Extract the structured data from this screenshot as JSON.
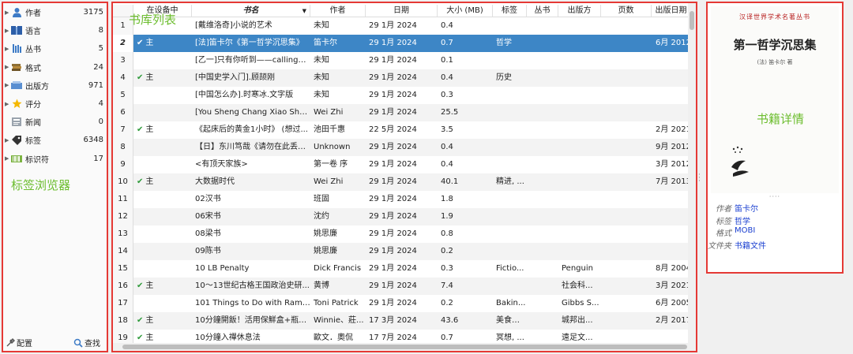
{
  "tag_browser": {
    "annotation": "标签浏览器",
    "items": [
      {
        "label": "作者",
        "count": "3175",
        "icon": "person-icon",
        "arrow": true
      },
      {
        "label": "语言",
        "count": "8",
        "icon": "language-icon",
        "arrow": true
      },
      {
        "label": "丛书",
        "count": "5",
        "icon": "series-icon",
        "arrow": true
      },
      {
        "label": "格式",
        "count": "24",
        "icon": "format-icon",
        "arrow": true
      },
      {
        "label": "出版方",
        "count": "971",
        "icon": "publisher-icon",
        "arrow": true
      },
      {
        "label": "评分",
        "count": "4",
        "icon": "star-icon",
        "arrow": true
      },
      {
        "label": "新闻",
        "count": "0",
        "icon": "news-icon",
        "arrow": false
      },
      {
        "label": "标签",
        "count": "6348",
        "icon": "tag-icon",
        "arrow": true
      },
      {
        "label": "标识符",
        "count": "17",
        "icon": "barcode-icon",
        "arrow": true
      }
    ],
    "configure_label": "配置",
    "find_label": "查找"
  },
  "library": {
    "annotation": "书库列表",
    "columns": {
      "on_device": "在设备中",
      "title": "书名",
      "author": "作者",
      "date": "日期",
      "size": "大小 (MB)",
      "tags": "标签",
      "series": "丛书",
      "publisher": "出版方",
      "pages": "页数",
      "published": "出版日期"
    },
    "rows": [
      {
        "num": "1",
        "device": "",
        "title": "[戴维洛奇]小说的艺术",
        "author": "未知",
        "date": "29 1月 2024",
        "size": "0.4",
        "tags": "",
        "series": "",
        "publisher": "",
        "pages": "",
        "published": ""
      },
      {
        "num": "2",
        "device": "主",
        "title": "[法]笛卡尔《第一哲学沉思集》",
        "author": "笛卡尔",
        "date": "29 1月 2024",
        "size": "0.7",
        "tags": "哲学",
        "series": "",
        "publisher": "",
        "pages": "",
        "published": "6月 2012"
      },
      {
        "num": "3",
        "device": "",
        "title": "[乙一]只有你听到——calling+y...",
        "author": "未知",
        "date": "29 1月 2024",
        "size": "0.1",
        "tags": "",
        "series": "",
        "publisher": "",
        "pages": "",
        "published": ""
      },
      {
        "num": "4",
        "device": "主",
        "title": "[中国史学入门].顾颉刚",
        "author": "未知",
        "date": "29 1月 2024",
        "size": "0.4",
        "tags": "历史",
        "series": "",
        "publisher": "",
        "pages": "",
        "published": ""
      },
      {
        "num": "5",
        "device": "",
        "title": "[中国怎么办].时寒冰.文字版",
        "author": "未知",
        "date": "29 1月 2024",
        "size": "0.3",
        "tags": "",
        "series": "",
        "publisher": "",
        "pages": "",
        "published": ""
      },
      {
        "num": "6",
        "device": "",
        "title": "[You Sheng Chang Xiao Shu ...",
        "author": "Wei Zhi",
        "date": "29 1月 2024",
        "size": "25.5",
        "tags": "",
        "series": "",
        "publisher": "",
        "pages": "",
        "published": ""
      },
      {
        "num": "7",
        "device": "主",
        "title": "《起床后的黄金1小时》 (想过...",
        "author": "池田千惠",
        "date": "22 5月 2024",
        "size": "3.5",
        "tags": "",
        "series": "",
        "publisher": "",
        "pages": "",
        "published": "2月 2021"
      },
      {
        "num": "8",
        "device": "",
        "title": "【日】东川笃哉《请勿在此丢弃...",
        "author": "Unknown",
        "date": "29 1月 2024",
        "size": "0.4",
        "tags": "",
        "series": "",
        "publisher": "",
        "pages": "",
        "published": "9月 2012"
      },
      {
        "num": "9",
        "device": "",
        "title": "<有顶天家族>",
        "author": "第一卷 序",
        "date": "29 1月 2024",
        "size": "0.4",
        "tags": "",
        "series": "",
        "publisher": "",
        "pages": "",
        "published": "3月 2012"
      },
      {
        "num": "10",
        "device": "主",
        "title": "大数据时代",
        "author": "Wei Zhi",
        "date": "29 1月 2024",
        "size": "40.1",
        "tags": "精进, ...",
        "series": "",
        "publisher": "",
        "pages": "",
        "published": "7月 2013"
      },
      {
        "num": "11",
        "device": "",
        "title": "02汉书",
        "author": "班固",
        "date": "29 1月 2024",
        "size": "1.8",
        "tags": "",
        "series": "",
        "publisher": "",
        "pages": "",
        "published": ""
      },
      {
        "num": "12",
        "device": "",
        "title": "06宋书",
        "author": "沈约",
        "date": "29 1月 2024",
        "size": "1.9",
        "tags": "",
        "series": "",
        "publisher": "",
        "pages": "",
        "published": ""
      },
      {
        "num": "13",
        "device": "",
        "title": "08梁书",
        "author": "姚思廉",
        "date": "29 1月 2024",
        "size": "0.8",
        "tags": "",
        "series": "",
        "publisher": "",
        "pages": "",
        "published": ""
      },
      {
        "num": "14",
        "device": "",
        "title": "09陈书",
        "author": "姚思廉",
        "date": "29 1月 2024",
        "size": "0.2",
        "tags": "",
        "series": "",
        "publisher": "",
        "pages": "",
        "published": ""
      },
      {
        "num": "15",
        "device": "",
        "title": "10 LB Penalty",
        "author": "Dick Francis",
        "date": "29 1月 2024",
        "size": "0.3",
        "tags": "Fictio...",
        "series": "",
        "publisher": "Penguin",
        "pages": "",
        "published": "8月 2004"
      },
      {
        "num": "16",
        "device": "主",
        "title": "10～13世纪古格王国政治史研...",
        "author": "黄博",
        "date": "29 1月 2024",
        "size": "7.4",
        "tags": "",
        "series": "",
        "publisher": "社会科...",
        "pages": "",
        "published": "3月 2021"
      },
      {
        "num": "17",
        "device": "",
        "title": "101 Things to Do with Ramen...",
        "author": "Toni Patrick",
        "date": "29 1月 2024",
        "size": "0.2",
        "tags": "Bakin...",
        "series": "",
        "publisher": "Gibbs S...",
        "pages": "",
        "published": "6月 2005"
      },
      {
        "num": "18",
        "device": "主",
        "title": "10分鐘開飯！活用保鮮盒+瓶罐...",
        "author": "Winnie、莊...",
        "date": "17 3月 2024",
        "size": "43.6",
        "tags": "美食休...",
        "series": "",
        "publisher": "城邦出...",
        "pages": "",
        "published": "2月 2017"
      },
      {
        "num": "19",
        "device": "主",
        "title": "10分鐘入禪休息法",
        "author": "歐文．奧侃",
        "date": "17 7月 2024",
        "size": "0.7",
        "tags": "冥想, ...",
        "series": "",
        "publisher": "遠足文...",
        "pages": "",
        "published": ""
      }
    ]
  },
  "details": {
    "annotation": "书籍详情",
    "cover_series": "汉译世界学术名著丛书",
    "cover_title": "第一哲学沉思集",
    "cover_author": "(法) 笛卡尔 著",
    "meta": [
      {
        "key": "作者",
        "value": "笛卡尔"
      },
      {
        "key": "标签",
        "value": "哲学"
      },
      {
        "key": "格式",
        "value": "MOBI"
      },
      {
        "key": "文件夹",
        "value": "书籍文件"
      }
    ]
  }
}
